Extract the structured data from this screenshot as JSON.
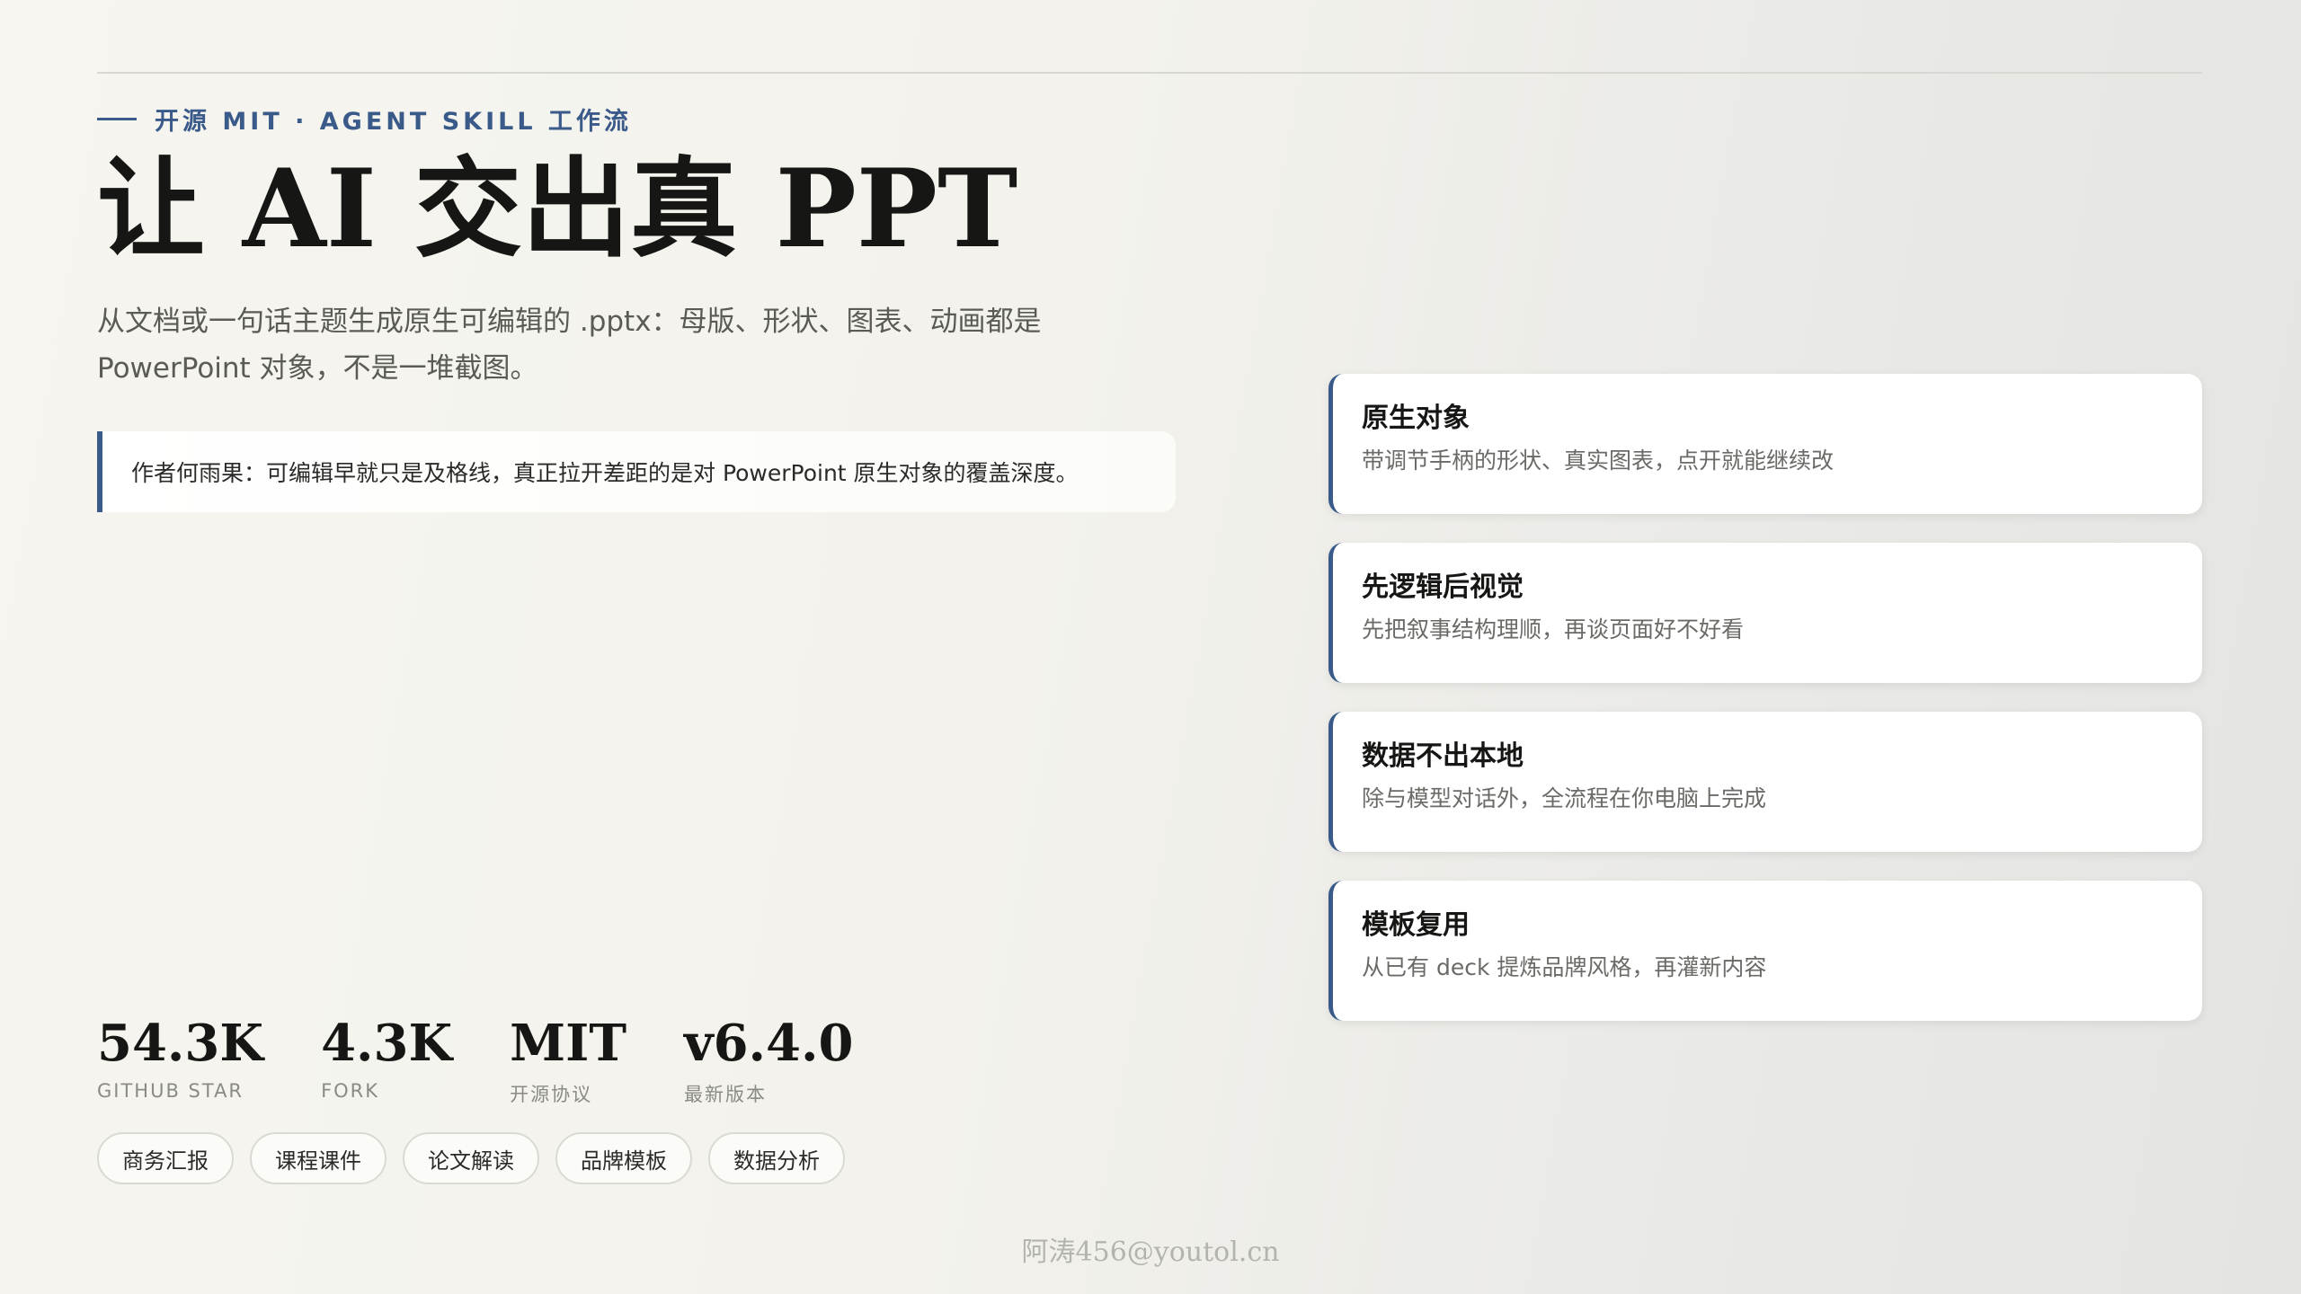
{
  "header": {
    "eyebrow": "开源 MIT · AGENT SKILL 工作流",
    "title": "让 AI 交出真 PPT",
    "subtitle": "从文档或一句话主题生成原生可编辑的 .pptx：母版、形状、图表、动画都是 PowerPoint 对象，不是一堆截图。"
  },
  "quote": {
    "text": "作者何雨果：可编辑早就只是及格线，真正拉开差距的是对 PowerPoint 原生对象的覆盖深度。"
  },
  "features": [
    {
      "title": "原生对象",
      "desc": "带调节手柄的形状、真实图表，点开就能继续改"
    },
    {
      "title": "先逻辑后视觉",
      "desc": "先把叙事结构理顺，再谈页面好不好看"
    },
    {
      "title": "数据不出本地",
      "desc": "除与模型对话外，全流程在你电脑上完成"
    },
    {
      "title": "模板复用",
      "desc": "从已有 deck 提炼品牌风格，再灌新内容"
    }
  ],
  "stats": [
    {
      "value": "54.3K",
      "label": "GITHUB STAR"
    },
    {
      "value": "4.3K",
      "label": "FORK"
    },
    {
      "value": "MIT",
      "label": "开源协议"
    },
    {
      "value": "v6.4.0",
      "label": "最新版本"
    }
  ],
  "tags": [
    "商务汇报",
    "课程课件",
    "论文解读",
    "品牌模板",
    "数据分析"
  ],
  "watermark": "阿涛456@youtol.cn",
  "colors": {
    "accent": "#3a5a8a",
    "background": "#f4f3ee",
    "card": "#ffffff"
  }
}
